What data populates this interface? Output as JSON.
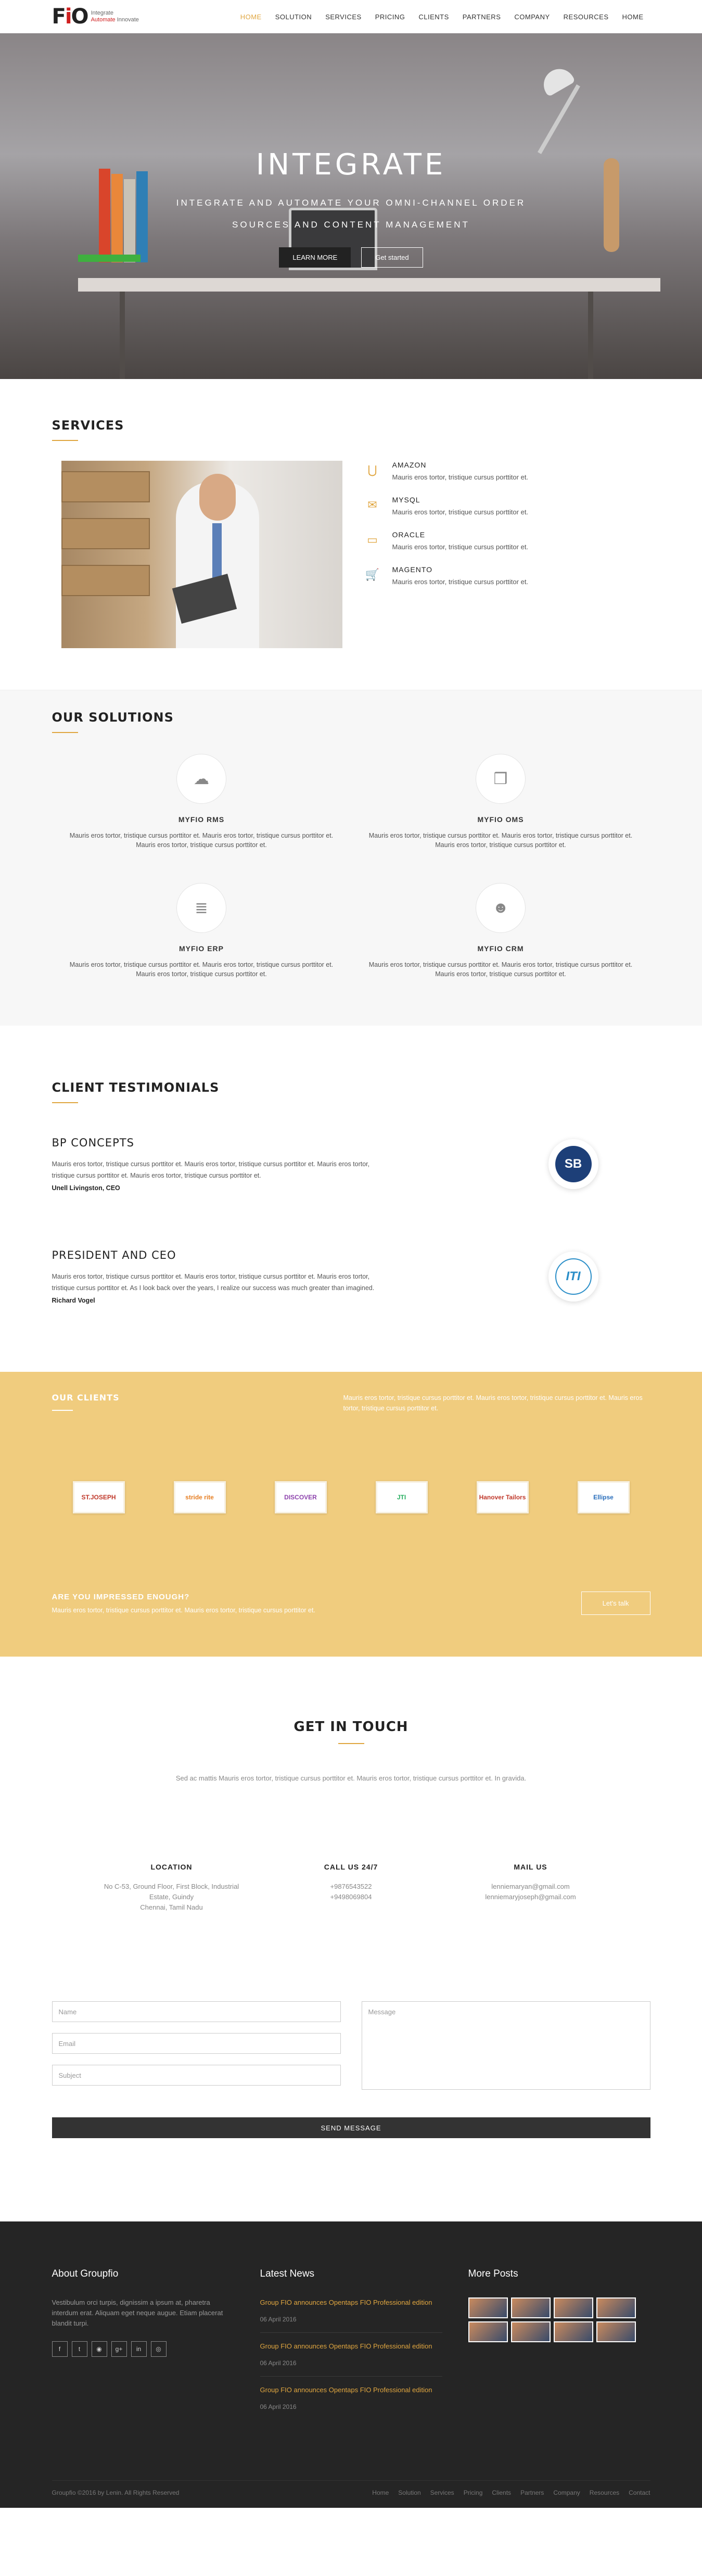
{
  "brand": {
    "mark": "FiO",
    "tag1": "Integrate",
    "tag2": "Automate",
    "tag3": "Innovate"
  },
  "nav": [
    "HOME",
    "SOLUTION",
    "SERVICES",
    "PRICING",
    "CLIENTS",
    "PARTNERS",
    "COMPANY",
    "RESOURCES",
    "HOME"
  ],
  "hero": {
    "title": "INTEGRATE",
    "line1": "INTEGRATE AND AUTOMATE YOUR OMNI-CHANNEL ORDER",
    "line2": "SOURCES AND CONTENT MANAGEMENT",
    "btn1": "LEARN MORE",
    "btn2": "Get started"
  },
  "services": {
    "title": "SERVICES",
    "items": [
      {
        "icon": "magnet-icon",
        "glyph": "⋃",
        "name": "AMAZON",
        "text": "Mauris eros tortor, tristique cursus porttitor et."
      },
      {
        "icon": "envelope-icon",
        "glyph": "✉",
        "name": "MYSQL",
        "text": "Mauris eros tortor, tristique cursus porttitor et."
      },
      {
        "icon": "id-card-icon",
        "glyph": "▭",
        "name": "ORACLE",
        "text": "Mauris eros tortor, tristique cursus porttitor et."
      },
      {
        "icon": "cart-icon",
        "glyph": "🛒",
        "name": "MAGENTO",
        "text": "Mauris eros tortor, tristique cursus porttitor et."
      }
    ]
  },
  "solutions": {
    "title": "OUR SOLUTIONS",
    "items": [
      {
        "icon": "cloud-upload-icon",
        "glyph": "☁",
        "name": "MYFIO RMS",
        "text": "Mauris eros tortor, tristique cursus porttitor et. Mauris eros tortor, tristique cursus porttitor et. Mauris eros tortor, tristique cursus porttitor et."
      },
      {
        "icon": "cubes-icon",
        "glyph": "❒",
        "name": "MYFIO OMS",
        "text": "Mauris eros tortor, tristique cursus porttitor et. Mauris eros tortor, tristique cursus porttitor et. Mauris eros tortor, tristique cursus porttitor et."
      },
      {
        "icon": "database-icon",
        "glyph": "≣",
        "name": "MYFIO ERP",
        "text": "Mauris eros tortor, tristique cursus porttitor et. Mauris eros tortor, tristique cursus porttitor et. Mauris eros tortor, tristique cursus porttitor et."
      },
      {
        "icon": "users-icon",
        "glyph": "☻",
        "name": "MYFIO CRM",
        "text": "Mauris eros tortor, tristique cursus porttitor et. Mauris eros tortor, tristique cursus porttitor et. Mauris eros tortor, tristique cursus porttitor et."
      }
    ]
  },
  "testimonials": {
    "title": "CLIENT TESTIMONIALS",
    "items": [
      {
        "company": "BP CONCEPTS",
        "text": "Mauris eros tortor, tristique cursus porttitor et. Mauris eros tortor, tristique cursus porttitor et. Mauris eros tortor, tristique cursus porttitor et. Mauris eros tortor, tristique cursus porttitor et.",
        "author": "Unell Livingston, CEO",
        "logo": "SB",
        "logo_color": "#1d3f78"
      },
      {
        "company": "PRESIDENT AND CEO",
        "text": "Mauris eros tortor, tristique cursus porttitor et. Mauris eros tortor, tristique cursus porttitor et. Mauris eros tortor, tristique cursus porttitor et. As I look back over the years, I realize our success was much greater than imagined.",
        "author": "Richard Vogel",
        "logo": "ITI",
        "logo_color": "#2a8ec8"
      }
    ]
  },
  "clients": {
    "title": "OUR CLIENTS",
    "text": "Mauris eros tortor, tristique cursus porttitor et. Mauris eros tortor, tristique cursus porttitor et. Mauris eros tortor, tristique cursus porttitor et.",
    "logos": [
      {
        "name": "ST.JOSEPH",
        "color": "#c0392b"
      },
      {
        "name": "stride rite",
        "color": "#e67e22"
      },
      {
        "name": "DISCOVER",
        "color": "#8e44ad"
      },
      {
        "name": "JTI",
        "color": "#27ae60"
      },
      {
        "name": "Hanover Tailors",
        "color": "#c0392b"
      },
      {
        "name": "Ellipse",
        "color": "#2a6ebb"
      }
    ],
    "cta_title": "ARE YOU IMPRESSED ENOUGH?",
    "cta_text": "Mauris eros tortor, tristique cursus porttitor et. Mauris eros tortor, tristique cursus porttitor et.",
    "cta_btn": "Let's talk"
  },
  "contact": {
    "title": "GET IN TOUCH",
    "lead": "Sed ac mattis Mauris eros tortor, tristique cursus porttitor et. Mauris eros tortor, tristique cursus porttitor et. In gravida.",
    "location_title": "LOCATION",
    "location_l1": "No C-53, Ground Floor, First Block, Industrial",
    "location_l2": "Estate, Guindy",
    "location_l3": "Chennai, Tamil Nadu",
    "call_title": "CALL US 24/7",
    "call_l1": "+9876543522",
    "call_l2": "+9498069804",
    "mail_title": "MAIL US",
    "mail_l1": "lenniemaryan@gmail.com",
    "mail_l2": "lenniemaryjoseph@gmail.com",
    "name_ph": "Name",
    "email_ph": "Email",
    "subject_ph": "Subject",
    "message_ph": "Message",
    "send": "SEND MESSAGE"
  },
  "footer": {
    "about_title": "About Groupfio",
    "about_text": "Vestibulum orci turpis, dignissim a ipsum at, pharetra interdum erat. Aliquam eget neque augue. Etiam placerat blandit turpi.",
    "social": [
      {
        "icon": "facebook-icon",
        "glyph": "f"
      },
      {
        "icon": "twitter-icon",
        "glyph": "t"
      },
      {
        "icon": "rss-icon",
        "glyph": "◉"
      },
      {
        "icon": "google-plus-icon",
        "glyph": "g+"
      },
      {
        "icon": "linkedin-icon",
        "glyph": "in"
      },
      {
        "icon": "dribbble-icon",
        "glyph": "◎"
      }
    ],
    "news_title": "Latest News",
    "news": [
      {
        "title": "Group FIO announces Opentaps FIO Professional edition",
        "date": "06 April 2016"
      },
      {
        "title": "Group FIO announces Opentaps FIO Professional edition",
        "date": "06 April 2016"
      },
      {
        "title": "Group FIO announces Opentaps FIO Professional edition",
        "date": "06 April 2016"
      }
    ],
    "posts_title": "More Posts",
    "copyright": "Groupfio ©2016 by Lenin. All Rights Reserved",
    "links": [
      "Home",
      "Solution",
      "Services",
      "Pricing",
      "Clients",
      "Partners",
      "Company",
      "Resources",
      "Contact"
    ]
  }
}
